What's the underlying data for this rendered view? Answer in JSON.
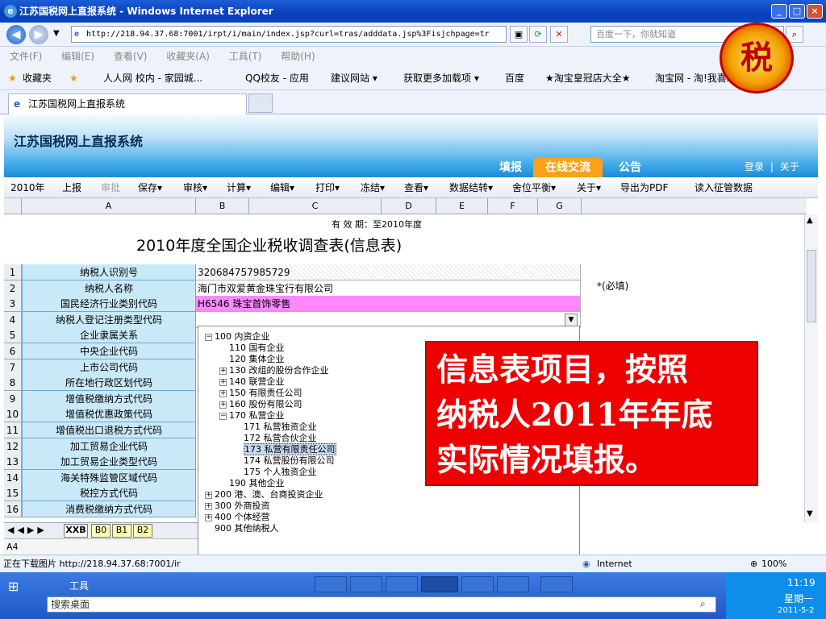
{
  "window": {
    "title": "江苏国税网上直报系统 - Windows Internet Explorer",
    "minimize": "_",
    "maximize": "□",
    "close": "×"
  },
  "browser": {
    "address": "http://218.94.37.68:7001/irpt/i/main/index.jsp?curl=tras/adddata.jsp%3Fisjchpage=tr",
    "search_placeholder": "百度一下，你就知道",
    "menu": [
      "文件(F)",
      "编辑(E)",
      "查看(V)",
      "收藏夹(A)",
      "工具(T)",
      "帮助(H)"
    ],
    "favorites_label": "收藏夹",
    "favorites": [
      "人人网 校内 - 家园城...",
      "QQ校友 - 应用",
      "建议网站 ▾",
      "获取更多加载项 ▾",
      "百度",
      "★淘宝皇冠店大全★",
      "淘宝网 - 淘!我喜欢"
    ],
    "tab_title": "江苏国税网上直报系统"
  },
  "app": {
    "emblem_char": "税",
    "system_name": "江苏国税网上直报系统",
    "nav": [
      "填报",
      "在线交流",
      "公告"
    ],
    "login": "登录",
    "about": "关于",
    "toolbar": [
      "2010年",
      "上报",
      "审批",
      "保存▾",
      "审核▾",
      "计算▾",
      "编辑▾",
      "打印▾",
      "冻结▾",
      "查看▾",
      "数据结转▾",
      "舍位平衡▾",
      "关于▾",
      "导出为PDF",
      "读入征管数据"
    ]
  },
  "sheet": {
    "columns": [
      "A",
      "B",
      "C",
      "D",
      "E",
      "F",
      "G"
    ],
    "header_partial": "有 效 期：至2010年度",
    "title": "2010年度全国企业税收调查表(信息表)",
    "rows": [
      {
        "num": "1",
        "label": "纳税人识别号",
        "value": "320684757985729"
      },
      {
        "num": "2",
        "label": "纳税人名称",
        "value": "海门市双爱黄金珠宝行有限公司"
      },
      {
        "num": "3",
        "label": "国民经济行业类别代码",
        "value": "H6546 珠宝首饰零售"
      },
      {
        "num": "4",
        "label": "纳税人登记注册类型代码",
        "value": ""
      },
      {
        "num": "5",
        "label": "企业隶属关系",
        "value": ""
      },
      {
        "num": "6",
        "label": "中央企业代码",
        "value": ""
      },
      {
        "num": "7",
        "label": "上市公司代码",
        "value": ""
      },
      {
        "num": "8",
        "label": "所在地行政区划代码",
        "value": ""
      },
      {
        "num": "9",
        "label": "增值税缴纳方式代码",
        "value": ""
      },
      {
        "num": "10",
        "label": "增值税优惠政策代码",
        "value": ""
      },
      {
        "num": "11",
        "label": "增值税出口退税方式代码",
        "value": ""
      },
      {
        "num": "12",
        "label": "加工贸易企业代码",
        "value": ""
      },
      {
        "num": "13",
        "label": "加工贸易企业类型代码",
        "value": ""
      },
      {
        "num": "14",
        "label": "海关特殊监管区域代码",
        "value": ""
      },
      {
        "num": "15",
        "label": "税控方式代码",
        "value": ""
      },
      {
        "num": "16",
        "label": "消费税缴纳方式代码",
        "value": ""
      }
    ],
    "required_note": "*(必填)",
    "tree": [
      {
        "text": "100 内资企业",
        "exp": "−"
      },
      {
        "text": "110 国有企业",
        "exp": ""
      },
      {
        "text": "120 集体企业",
        "exp": ""
      },
      {
        "text": "130 改组的股份合作企业",
        "exp": "+"
      },
      {
        "text": "140 联营企业",
        "exp": "+"
      },
      {
        "text": "150 有限责任公司",
        "exp": "+"
      },
      {
        "text": "160 股份有限公司",
        "exp": "+"
      },
      {
        "text": "170 私营企业",
        "exp": "−"
      },
      {
        "text": "171 私营独资企业",
        "exp": ""
      },
      {
        "text": "172 私营合伙企业",
        "exp": ""
      },
      {
        "text": "173 私营有限责任公司",
        "exp": ""
      },
      {
        "text": "174 私营股份有限公司",
        "exp": ""
      },
      {
        "text": "175 个人独资企业",
        "exp": ""
      },
      {
        "text": "190 其他企业",
        "exp": ""
      },
      {
        "text": "200 港、澳、台商投资企业",
        "exp": "+"
      },
      {
        "text": "300 外商投资",
        "exp": "+"
      },
      {
        "text": "400 个体经营",
        "exp": "+"
      },
      {
        "text": "900 其他纳税人",
        "exp": ""
      }
    ],
    "sheet_tabs": [
      "XXB",
      "B0",
      "B1",
      "B2"
    ],
    "cell_ref": "A4"
  },
  "overlay": {
    "lines": [
      "信息表项目，按照",
      "纳税人2011年年底",
      "实际情况填报。"
    ]
  },
  "status": {
    "text": "正在下载图片 http://218.94.37.68:7001/ir",
    "zone": "Internet",
    "zoom": "100%"
  },
  "taskbar": {
    "tools": "工具",
    "search_placeholder": "搜索桌面",
    "time": "11:19",
    "weekday": "星期一",
    "date": "2011-5-2"
  },
  "colors": {
    "accent": "#1c8ad8",
    "overlay": "#ee0000",
    "label_bg": "#c9e9f8",
    "highlight": "#ff88ff"
  }
}
